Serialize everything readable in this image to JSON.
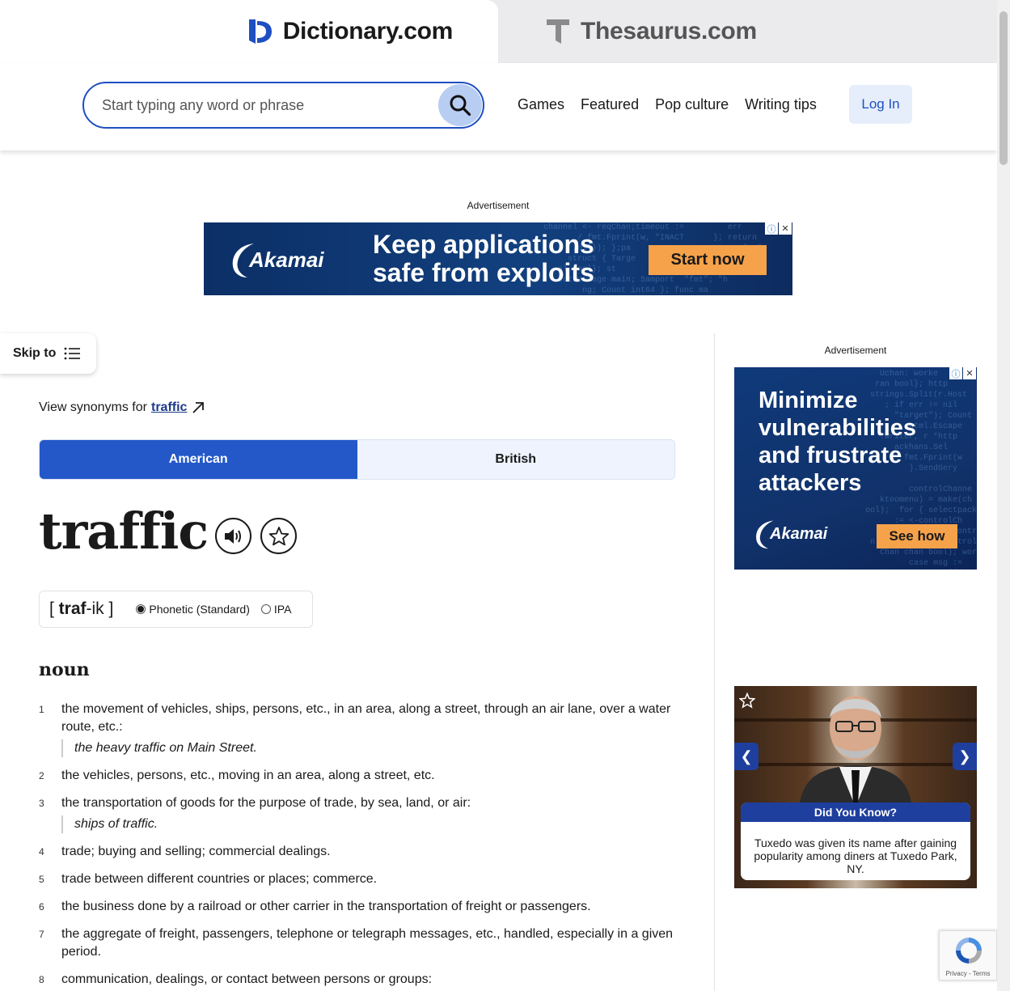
{
  "tabs": {
    "dictionary": "Dictionary.com",
    "thesaurus": "Thesaurus.com"
  },
  "search": {
    "placeholder": "Start typing any word or phrase"
  },
  "nav": {
    "items": [
      "Games",
      "Featured",
      "Pop culture",
      "Writing tips"
    ],
    "login": "Log In"
  },
  "top_ad": {
    "label": "Advertisement",
    "brand": "Akamai",
    "headline_1": "Keep applications",
    "headline_2": "safe from exploits",
    "cta": "Start now"
  },
  "skip_to": "Skip to",
  "synonyms": {
    "prefix": "View synonyms for",
    "word": "traffic"
  },
  "dialect_toggle": {
    "american": "American",
    "british": "British",
    "selected": "American"
  },
  "entry": {
    "word": "traffic",
    "pron_open": "[ ",
    "pron_stress": "traf",
    "pron_rest": "-ik",
    "pron_close": " ]",
    "phonetic_label": "Phonetic (Standard)",
    "ipa_label": "IPA",
    "part_of_speech": "noun"
  },
  "definitions": [
    {
      "num": "1",
      "text": "the movement of vehicles, ships, persons, etc., in an area, along a street, through an air lane, over a water route, etc.:",
      "example": "the heavy traffic on Main Street."
    },
    {
      "num": "2",
      "text": "the vehicles, persons, etc., moving in an area, along a street, etc.",
      "example": ""
    },
    {
      "num": "3",
      "text": "the transportation of goods for the purpose of trade, by sea, land, or air:",
      "example": "ships of traffic."
    },
    {
      "num": "4",
      "text": "trade; buying and selling; commercial dealings.",
      "example": ""
    },
    {
      "num": "5",
      "text": "trade between different countries or places; commerce.",
      "example": ""
    },
    {
      "num": "6",
      "text": "the business done by a railroad or other carrier in the transportation of freight or passengers.",
      "example": ""
    },
    {
      "num": "7",
      "text": "the aggregate of freight, passengers, telephone or telegraph messages, etc., handled, especially in a given period.",
      "example": ""
    },
    {
      "num": "8",
      "text": "communication, dealings, or contact between persons or groups:",
      "example": ""
    }
  ],
  "side_ad": {
    "label": "Advertisement",
    "headline_1": "Minimize",
    "headline_2": "vulnerabilities",
    "headline_3": "and frustrate",
    "headline_4": "attackers",
    "brand": "Akamai",
    "cta": "See how"
  },
  "did_you_know": {
    "title": "Did You Know?",
    "text": "Tuxedo was given its name after gaining popularity among diners at Tuxedo Park, NY."
  },
  "recaptcha": {
    "footer": "Privacy - Terms"
  },
  "colors": {
    "brand_blue": "#1e4fc2",
    "toggle_active": "#2458c9",
    "ad_cta": "#f6a24a",
    "dyk_blue": "#1f3f9e"
  }
}
